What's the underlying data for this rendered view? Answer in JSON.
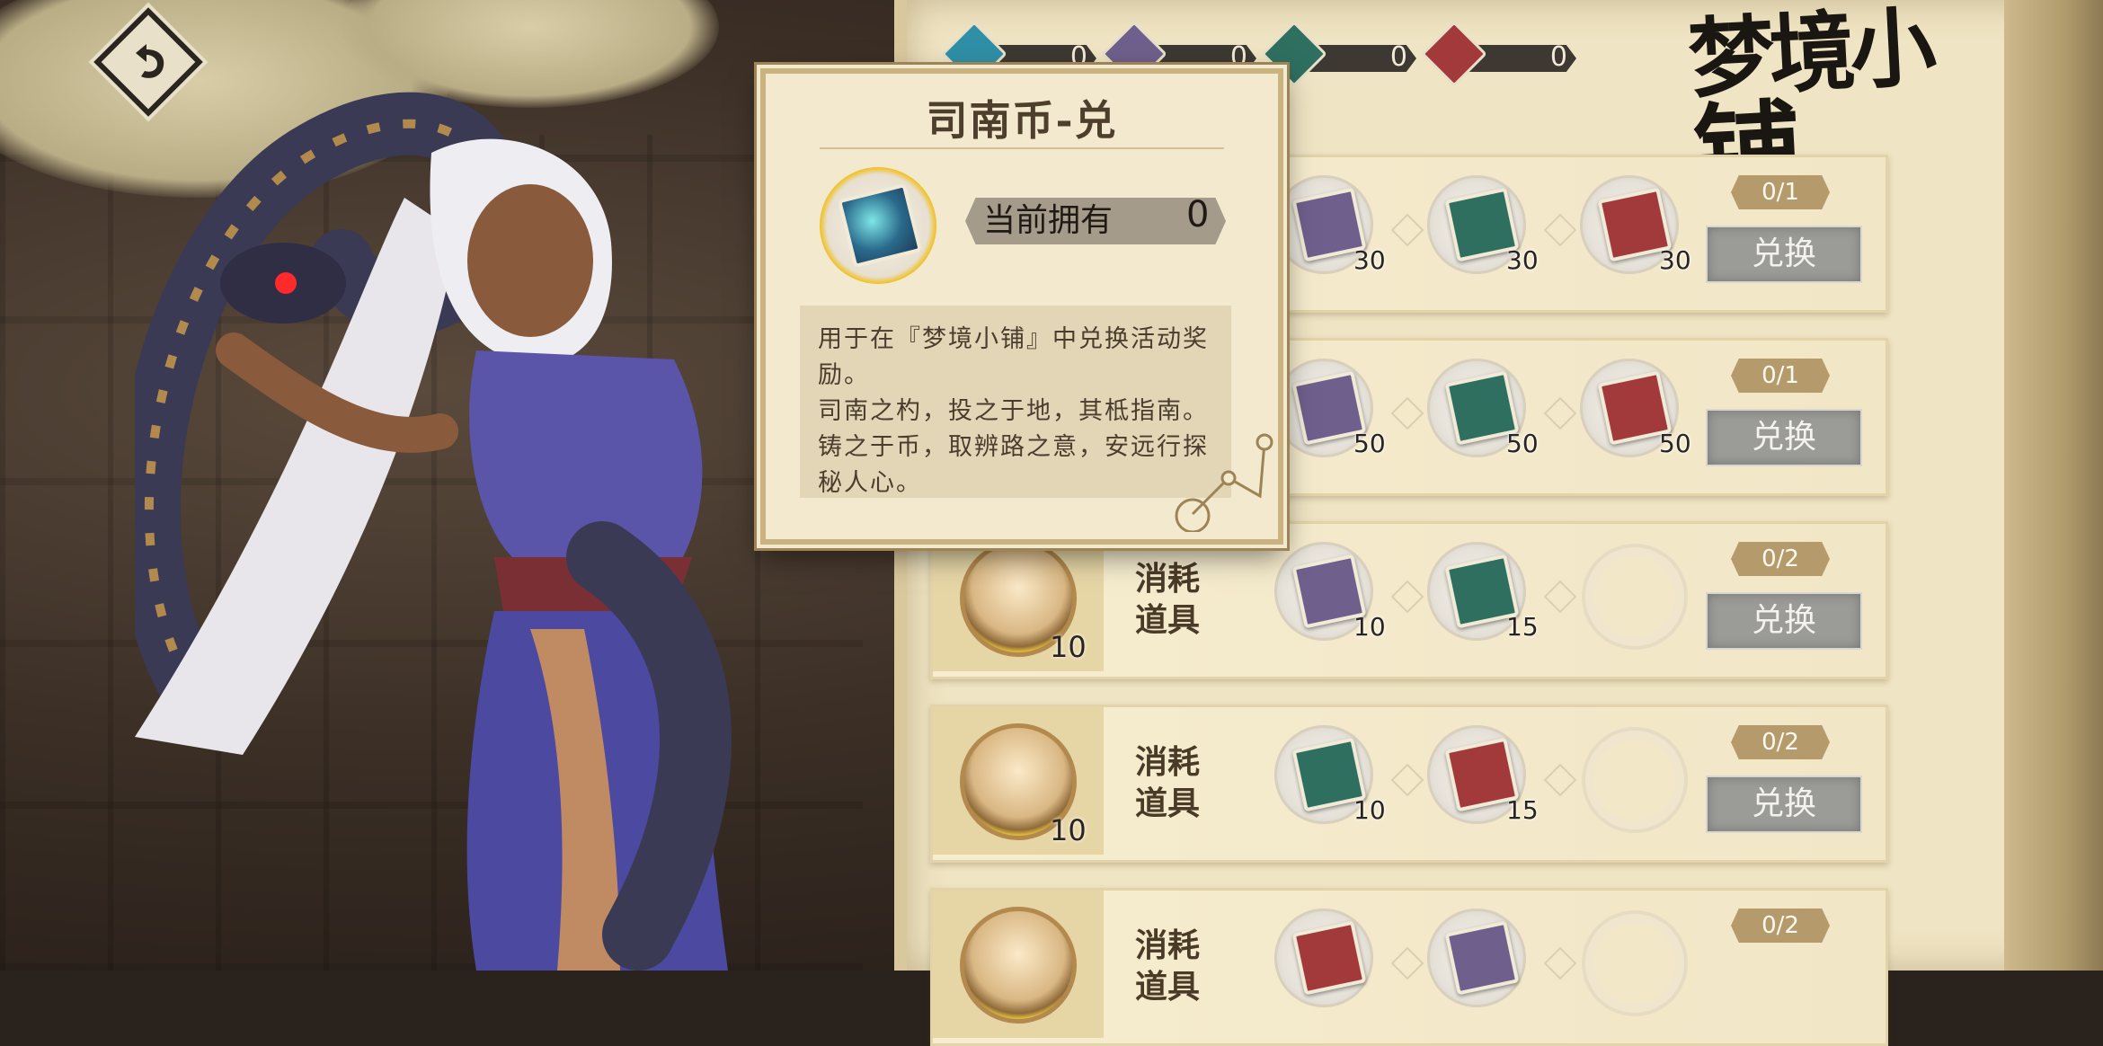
{
  "title_logo": {
    "line1": "梦境小",
    "line2": "铺"
  },
  "back_button": {
    "icon": "back-arrow-icon"
  },
  "currencies": [
    {
      "name": "司南币-兑",
      "icon": "teal-coin-icon",
      "color": "#2f8fa6",
      "value": "0"
    },
    {
      "name": "",
      "icon": "purple-coin-icon",
      "color": "#6f5f8c",
      "value": "0"
    },
    {
      "name": "",
      "icon": "green-coin-icon",
      "color": "#2f6f60",
      "value": "0"
    },
    {
      "name": "",
      "icon": "red-coin-icon",
      "color": "#a23a3c",
      "value": "0"
    }
  ],
  "tooltip": {
    "title": "司南币-兑",
    "owned_label": "当前拥有",
    "owned_value": "0",
    "desc_line1": "用于在『梦境小铺』中兑换活动奖励。",
    "desc_line2": "司南之杓，投之于地，其柢指南。铸之于币，取辨路之意，安远行探秘人心。"
  },
  "rows": [
    {
      "label": "",
      "reward_count": "",
      "costs": [
        {
          "icon": "purple-coin-icon",
          "color": "#6f5f8c",
          "qty": "30"
        },
        {
          "icon": "green-coin-icon",
          "color": "#2f6f60",
          "qty": "30"
        },
        {
          "icon": "red-coin-icon",
          "color": "#a23a3c",
          "qty": "30"
        }
      ],
      "limit": "0/1",
      "button": "兑换"
    },
    {
      "label": "",
      "reward_count": "",
      "costs": [
        {
          "icon": "purple-coin-icon",
          "color": "#6f5f8c",
          "qty": "50"
        },
        {
          "icon": "green-coin-icon",
          "color": "#2f6f60",
          "qty": "50"
        },
        {
          "icon": "red-coin-icon",
          "color": "#a23a3c",
          "qty": "50"
        }
      ],
      "limit": "0/1",
      "button": "兑换"
    },
    {
      "label": "消耗道具",
      "reward_count": "10",
      "costs": [
        {
          "icon": "purple-coin-icon",
          "color": "#6f5f8c",
          "qty": "10"
        },
        {
          "icon": "green-coin-icon",
          "color": "#2f6f60",
          "qty": "15"
        }
      ],
      "limit": "0/2",
      "button": "兑换"
    },
    {
      "label": "消耗道具",
      "reward_count": "10",
      "costs": [
        {
          "icon": "green-coin-icon",
          "color": "#2f6f60",
          "qty": "10"
        },
        {
          "icon": "red-coin-icon",
          "color": "#a23a3c",
          "qty": "15"
        }
      ],
      "limit": "0/2",
      "button": "兑换"
    },
    {
      "label": "消耗道具",
      "reward_count": "",
      "costs": [
        {
          "icon": "red-coin-icon",
          "color": "#a23a3c",
          "qty": ""
        },
        {
          "icon": "purple-coin-icon",
          "color": "#6f5f8c",
          "qty": ""
        }
      ],
      "limit": "0/2",
      "button": ""
    }
  ]
}
